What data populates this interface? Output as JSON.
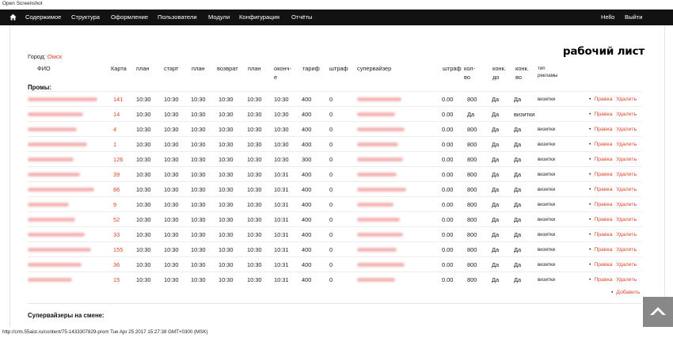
{
  "window_title": "Open Screenshot",
  "nav": {
    "items": [
      {
        "label": "Содержимое"
      },
      {
        "label": "Структура"
      },
      {
        "label": "Оформление"
      },
      {
        "label": "Пользователи"
      },
      {
        "label": "Модули"
      },
      {
        "label": "Конфигурация"
      },
      {
        "label": "Отчёты"
      }
    ],
    "hello": "Hello",
    "logout": "Выйти"
  },
  "page": {
    "title": "рабочий лист",
    "city_label": "Город:",
    "city_value": "Омск"
  },
  "table": {
    "headers": {
      "fio": "ФИО",
      "card": "Карта",
      "plan1": "план",
      "start": "старт",
      "plan2": "план",
      "return": "возврат",
      "plan3": "план",
      "end": "оконч-\nе",
      "tariff": "тариф",
      "fine1": "штраф",
      "supervisor": "супервайзер",
      "fine2": "штраф",
      "qty": "кол-\nво",
      "konk1": "конк.\nдо",
      "konk2": "конк.\nво",
      "adtype": "тип\nрекламы"
    },
    "section": "Промы:",
    "rows": [
      {
        "card": "141",
        "plan1": "10:30",
        "start": "10:30",
        "plan2": "10:30",
        "ret": "10:30",
        "plan3": "10:30",
        "end": "10:30",
        "tariff": "400",
        "fine1": "0",
        "fine2": "0.00",
        "qty": "800",
        "k1": "Да",
        "k2": "Да",
        "ad": "визитки"
      },
      {
        "card": "14",
        "plan1": "10:30",
        "start": "10:30",
        "plan2": "10:30",
        "ret": "10:30",
        "plan3": "10:30",
        "end": "10:30",
        "tariff": "400",
        "fine1": "0",
        "fine2": "0.00",
        "qty": "Да",
        "k1": "Да",
        "k2": "визитки",
        "ad": ""
      },
      {
        "card": "4",
        "plan1": "10:30",
        "start": "10:30",
        "plan2": "10:30",
        "ret": "10:30",
        "plan3": "10:30",
        "end": "10:30",
        "tariff": "400",
        "fine1": "0",
        "fine2": "0.00",
        "qty": "800",
        "k1": "Да",
        "k2": "Да",
        "ad": "визитки"
      },
      {
        "card": "1",
        "plan1": "10:30",
        "start": "10:30",
        "plan2": "10:30",
        "ret": "10:30",
        "plan3": "10:30",
        "end": "10:30",
        "tariff": "400",
        "fine1": "0",
        "fine2": "0.00",
        "qty": "800",
        "k1": "Да",
        "k2": "Да",
        "ad": "визитки"
      },
      {
        "card": "126",
        "plan1": "10:30",
        "start": "10:30",
        "plan2": "10:30",
        "ret": "10:30",
        "plan3": "10:30",
        "end": "10:30",
        "tariff": "300",
        "fine1": "0",
        "fine2": "0.00",
        "qty": "800",
        "k1": "Да",
        "k2": "Да",
        "ad": "визитки"
      },
      {
        "card": "39",
        "plan1": "10:30",
        "start": "10:30",
        "plan2": "10:30",
        "ret": "10:30",
        "plan3": "10:30",
        "end": "10:31",
        "tariff": "400",
        "fine1": "0",
        "fine2": "0.00",
        "qty": "800",
        "k1": "Да",
        "k2": "Да",
        "ad": "визитки"
      },
      {
        "card": "86",
        "plan1": "10:30",
        "start": "10:30",
        "plan2": "10:30",
        "ret": "10:30",
        "plan3": "10:30",
        "end": "10:31",
        "tariff": "400",
        "fine1": "0",
        "fine2": "0.00",
        "qty": "800",
        "k1": "Да",
        "k2": "Да",
        "ad": "визитки"
      },
      {
        "card": "9",
        "plan1": "10:30",
        "start": "10:30",
        "plan2": "10:30",
        "ret": "10:30",
        "plan3": "10:30",
        "end": "10:31",
        "tariff": "400",
        "fine1": "0",
        "fine2": "0.00",
        "qty": "800",
        "k1": "Да",
        "k2": "Да",
        "ad": "визитки"
      },
      {
        "card": "52",
        "plan1": "10:30",
        "start": "10:30",
        "plan2": "10:30",
        "ret": "10:30",
        "plan3": "10:30",
        "end": "10:31",
        "tariff": "400",
        "fine1": "0",
        "fine2": "0.00",
        "qty": "800",
        "k1": "Да",
        "k2": "Да",
        "ad": "визитки"
      },
      {
        "card": "33",
        "plan1": "10:30",
        "start": "10:30",
        "plan2": "10:30",
        "ret": "10:30",
        "plan3": "10:30",
        "end": "10:31",
        "tariff": "400",
        "fine1": "0",
        "fine2": "0.00",
        "qty": "800",
        "k1": "Да",
        "k2": "Да",
        "ad": "визитки"
      },
      {
        "card": "155",
        "plan1": "10:30",
        "start": "10:30",
        "plan2": "10:30",
        "ret": "10:30",
        "plan3": "10:30",
        "end": "10:31",
        "tariff": "400",
        "fine1": "0",
        "fine2": "0.00",
        "qty": "800",
        "k1": "Да",
        "k2": "Да",
        "ad": "визитки"
      },
      {
        "card": "36",
        "plan1": "10:30",
        "start": "10:30",
        "plan2": "10:30",
        "ret": "10:30",
        "plan3": "10:30",
        "end": "10:31",
        "tariff": "400",
        "fine1": "0",
        "fine2": "0.00",
        "qty": "800",
        "k1": "Да",
        "k2": "Да",
        "ad": "визитки"
      },
      {
        "card": "15",
        "plan1": "10:30",
        "start": "10:30",
        "plan2": "10:30",
        "ret": "10:30",
        "plan3": "10:30",
        "end": "10:31",
        "tariff": "400",
        "fine1": "0",
        "fine2": "0.00",
        "qty": "800",
        "k1": "Да",
        "k2": "Да",
        "ad": "визитки"
      }
    ],
    "action_edit": "Правка",
    "action_delete": "Удалить",
    "add_label": "Добавить"
  },
  "supervisors_section": "Супервайзеры на смене:",
  "status_text": "http://crm.55aist.ru/content/75-1433307829-prom Tue Apr 25 2017 15:27:38 GMT+0300 (MSK)",
  "icons": {
    "home": "home-icon",
    "scroll_top": "arrow-up-icon"
  },
  "colors": {
    "accent": "#e0442a",
    "navbar": "#121212"
  }
}
